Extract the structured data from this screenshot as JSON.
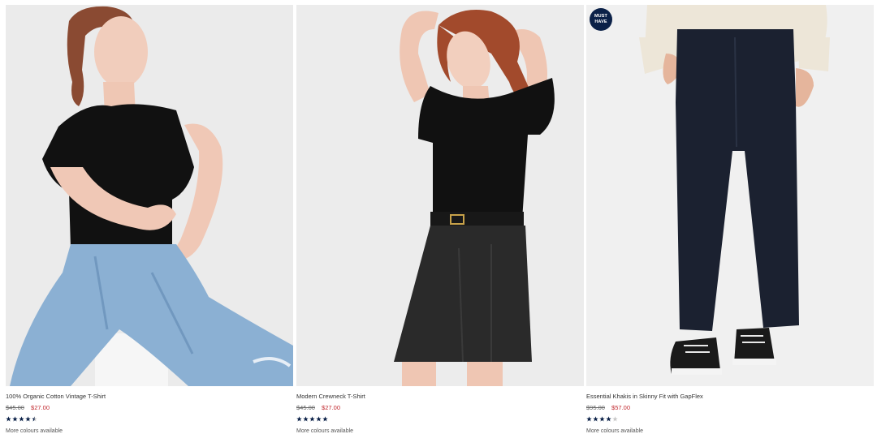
{
  "products": [
    {
      "name": "100% Organic Cotton Vintage T-Shirt",
      "original_price": "$45.00",
      "sale_price": "$27.00",
      "rating": 4.5,
      "colours_link": "More colours available",
      "badge": null
    },
    {
      "name": "Modern Crewneck T-Shirt",
      "original_price": "$45.00",
      "sale_price": "$27.00",
      "rating": 5,
      "colours_link": "More colours available",
      "badge": null
    },
    {
      "name": "Essential Khakis in Skinny Fit with GapFlex",
      "original_price": "$95.00",
      "sale_price": "$57.00",
      "rating": 4,
      "colours_link": "More colours available",
      "badge": {
        "line1": "MUST",
        "line2": "HAVE"
      }
    }
  ],
  "colors": {
    "star_filled": "#0b2148",
    "star_empty": "#c8c8c8",
    "sale_price": "#c1272d",
    "badge_bg": "#0b2148"
  }
}
